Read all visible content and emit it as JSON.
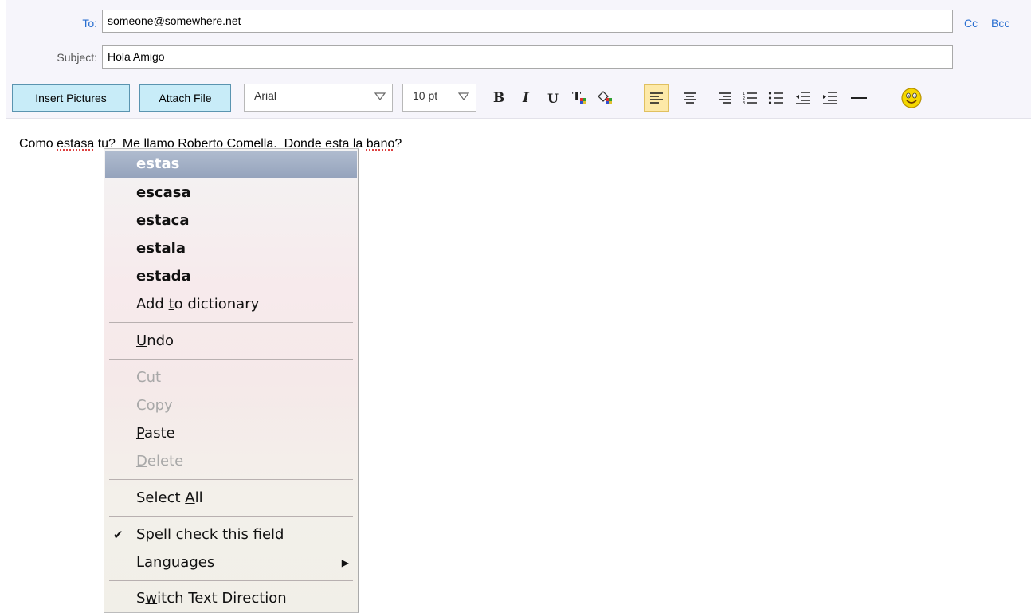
{
  "compose": {
    "to_label": "To:",
    "to_value": "someone@somewhere.net",
    "subject_label": "Subject:",
    "subject_value": "Hola Amigo",
    "cc": "Cc",
    "bcc": "Bcc"
  },
  "toolbar": {
    "insert_pictures": "Insert Pictures",
    "attach_file": "Attach File",
    "font": "Arial",
    "size": "10 pt",
    "bold_label": "B",
    "italic_label": "I",
    "underline_label": "U"
  },
  "body": {
    "part1": "Como ",
    "word1": "estasa",
    "part2": " tu?  Me llamo Roberto Comella.  Donde esta la ",
    "word2": "bano",
    "part3": "?"
  },
  "context_menu": {
    "suggestions": [
      "estas",
      "escasa",
      "estaca",
      "estala",
      "estada"
    ],
    "add_to_dictionary": {
      "pre": "Add ",
      "mn": "t",
      "post": "o dictionary"
    },
    "undo": {
      "pre": "",
      "mn": "U",
      "post": "ndo"
    },
    "cut": {
      "pre": "Cu",
      "mn": "t",
      "post": ""
    },
    "copy": {
      "pre": "",
      "mn": "C",
      "post": "opy"
    },
    "paste": {
      "pre": "",
      "mn": "P",
      "post": "aste"
    },
    "delete": {
      "pre": "",
      "mn": "D",
      "post": "elete"
    },
    "select_all": {
      "pre": "Select ",
      "mn": "A",
      "post": "ll"
    },
    "spell_check": {
      "pre": "",
      "mn": "S",
      "post": "pell check this field"
    },
    "languages": {
      "pre": "",
      "mn": "L",
      "post": "anguages"
    },
    "switch_direction": {
      "pre": "S",
      "mn": "w",
      "post": "itch Text Direction"
    },
    "spell_check_checked": true
  },
  "colors": {
    "link": "#2a6fd0",
    "button_bg": "#c8ecf8",
    "active_align": "#fde9a8",
    "menu_highlight": "#a0aec4"
  }
}
